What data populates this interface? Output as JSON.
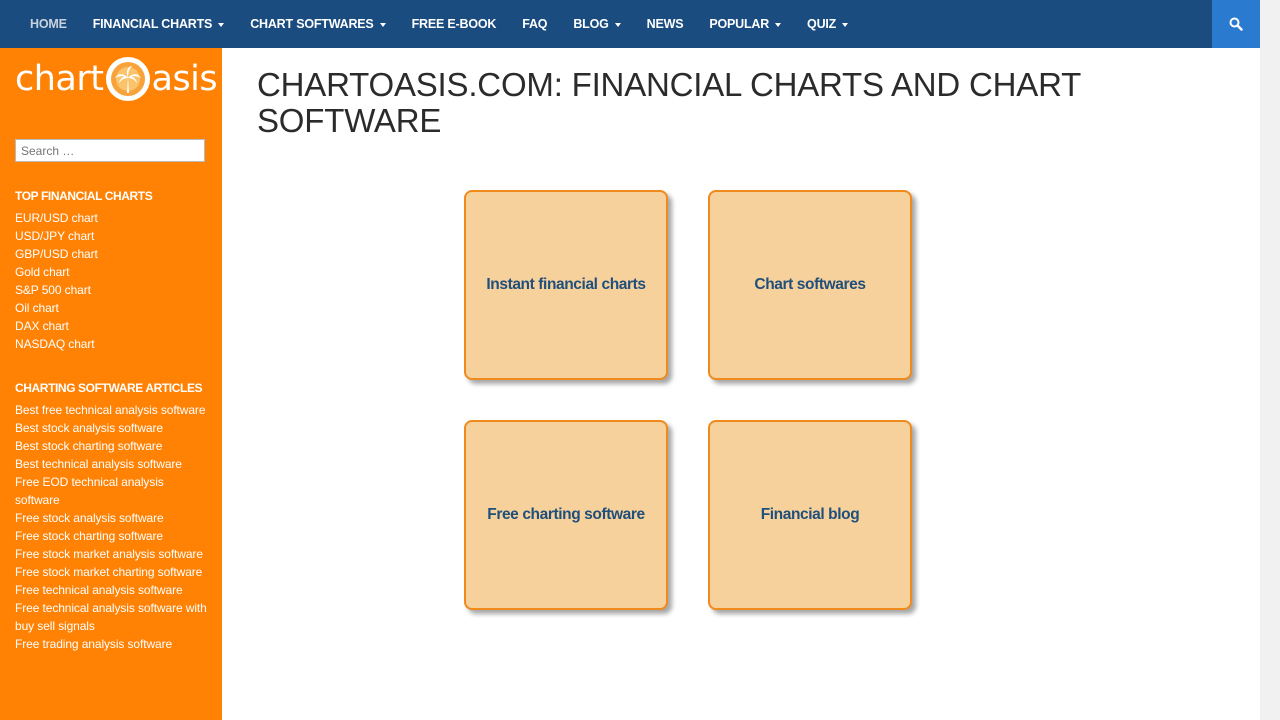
{
  "nav": {
    "items": [
      {
        "label": "HOME",
        "dropdown": false
      },
      {
        "label": "FINANCIAL CHARTS",
        "dropdown": true
      },
      {
        "label": "CHART SOFTWARES",
        "dropdown": true
      },
      {
        "label": "FREE E-BOOK",
        "dropdown": false
      },
      {
        "label": "FAQ",
        "dropdown": false
      },
      {
        "label": "BLOG",
        "dropdown": true
      },
      {
        "label": "NEWS",
        "dropdown": false
      },
      {
        "label": "POPULAR",
        "dropdown": true
      },
      {
        "label": "QUIZ",
        "dropdown": true
      }
    ],
    "search_icon": "search-icon"
  },
  "sidebar": {
    "logo": {
      "left_text": "chart",
      "right_text": "asis"
    },
    "search_placeholder": "Search …",
    "sections": [
      {
        "heading": "TOP FINANCIAL CHARTS",
        "items": [
          "EUR/USD chart",
          "USD/JPY chart",
          "GBP/USD chart",
          "Gold chart",
          "S&P 500 chart",
          "Oil chart",
          "DAX chart",
          "NASDAQ chart"
        ]
      },
      {
        "heading": "CHARTING SOFTWARE ARTICLES",
        "items": [
          "Best free technical analysis software",
          "Best stock analysis software",
          "Best stock charting software",
          "Best technical analysis software",
          "Free EOD technical analysis software",
          "Free stock analysis software",
          "Free stock charting software",
          "Free stock market analysis software",
          "Free stock market charting software",
          "Free technical analysis software",
          "Free technical analysis software with buy sell signals",
          "Free trading analysis software"
        ]
      }
    ]
  },
  "main": {
    "title": "CHARTOASIS.COM: FINANCIAL CHARTS AND CHART SOFTWARE",
    "tiles": [
      {
        "label": "Instant financial charts"
      },
      {
        "label": "Chart softwares"
      },
      {
        "label": "Free charting software"
      },
      {
        "label": "Financial blog"
      }
    ]
  },
  "colors": {
    "topbar": "#1a4c80",
    "sidebar": "#ff8205",
    "tile_fill": "#f7d19c",
    "tile_border": "#f08a1c",
    "tile_text": "#1f4f7a",
    "search_button": "#2a7ad0"
  }
}
